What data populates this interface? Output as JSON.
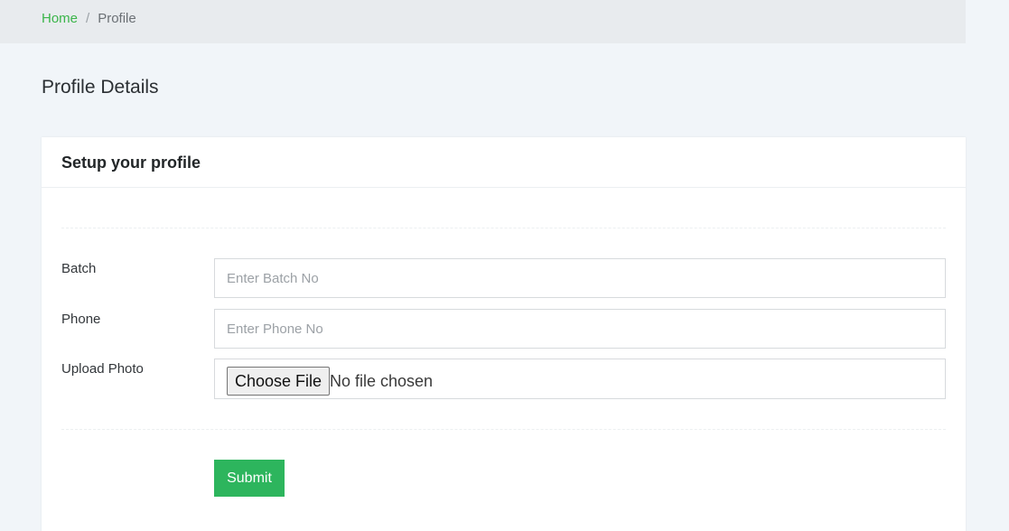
{
  "breadcrumb": {
    "home_label": "Home",
    "separator": "/",
    "current_label": "Profile"
  },
  "page": {
    "title": "Profile Details"
  },
  "card": {
    "title": "Setup your profile"
  },
  "form": {
    "batch": {
      "label": "Batch",
      "value": "",
      "placeholder": "Enter Batch No"
    },
    "phone": {
      "label": "Phone",
      "value": "",
      "placeholder": "Enter Phone No"
    },
    "photo": {
      "label": "Upload Photo",
      "button_label": "Choose File",
      "status": "No file chosen"
    },
    "submit_label": "Submit"
  },
  "colors": {
    "accent": "#2db55d",
    "link": "#3bb54a",
    "page_background": "#f1f5f9",
    "breadcrumb_background": "#e8ebee",
    "card_background": "#ffffff"
  }
}
